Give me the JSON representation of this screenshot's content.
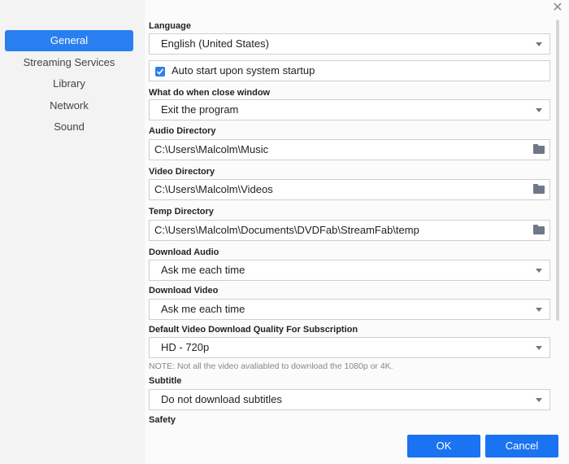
{
  "sidebar": {
    "items": [
      {
        "label": "General",
        "active": true
      },
      {
        "label": "Streaming Services"
      },
      {
        "label": "Library"
      },
      {
        "label": "Network"
      },
      {
        "label": "Sound"
      }
    ]
  },
  "settings": {
    "language": {
      "label": "Language",
      "value": "English (United States)"
    },
    "auto_start": {
      "label": "Auto start upon system startup",
      "checked": true
    },
    "close_window": {
      "label": "What do when close window",
      "value": "Exit the program"
    },
    "audio_dir": {
      "label": "Audio Directory",
      "value": "C:\\Users\\Malcolm\\Music"
    },
    "video_dir": {
      "label": "Video Directory",
      "value": "C:\\Users\\Malcolm\\Videos"
    },
    "temp_dir": {
      "label": "Temp Directory",
      "value": "C:\\Users\\Malcolm\\Documents\\DVDFab\\StreamFab\\temp"
    },
    "download_audio": {
      "label": "Download Audio",
      "value": "Ask me each time"
    },
    "download_video": {
      "label": "Download Video",
      "value": "Ask me each time"
    },
    "quality": {
      "label": "Default Video Download Quality For Subscription",
      "value": "HD - 720p"
    },
    "note": "NOTE: Not all the video avaliabled to download the 1080p or 4K.",
    "subtitle": {
      "label": "Subtitle",
      "value": "Do not download subtitles"
    },
    "safety": {
      "label": "Safety"
    }
  },
  "buttons": {
    "ok": "OK",
    "cancel": "Cancel"
  },
  "icons": {
    "close": "close-icon",
    "folder": "folder-icon",
    "dropdown": "chevron-down-icon",
    "check": "check-icon"
  },
  "colors": {
    "accent": "#1a73f0",
    "sidebar_active": "#2a7ff0"
  }
}
